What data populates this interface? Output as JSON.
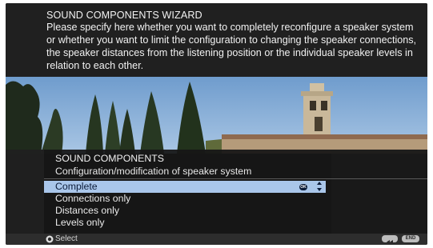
{
  "wizard": {
    "title": "SOUND COMPONENTS WIZARD",
    "description": "Please specify here whether you want to completely reconfigure a speaker system or whether you want to limit the configuration to changing the speaker connections, the speaker distances from the listening position or the individual speaker levels in relation to each other."
  },
  "menu": {
    "title": "SOUND COMPONENTS",
    "subtitle": "Configuration/modification of speaker system",
    "options": [
      {
        "label": "Complete"
      },
      {
        "label": "Connections only"
      },
      {
        "label": "Distances only"
      },
      {
        "label": "Levels only"
      }
    ],
    "ok_badge": "OK"
  },
  "footer": {
    "select_label": "Select",
    "end_label": "END"
  },
  "colors": {
    "selection_bg": "#a9c6ea",
    "panel_bg": "#202020",
    "text": "#f2f2f2"
  },
  "icons": [
    "ok-icon",
    "up-down-arrows-icon",
    "select-dial-icon",
    "back-icon",
    "end-icon"
  ]
}
